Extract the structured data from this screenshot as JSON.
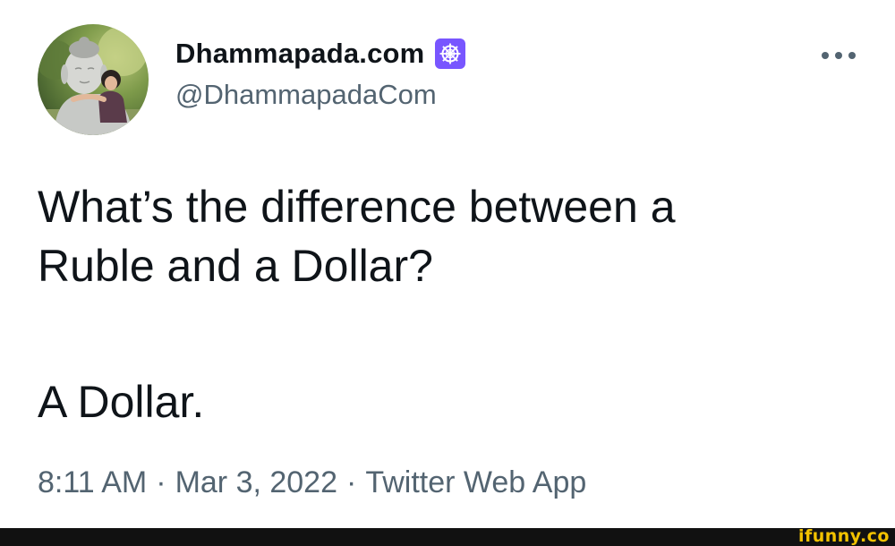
{
  "account": {
    "display_name": "Dhammapada.com",
    "handle": "@DhammapadaCom",
    "badge_icon": "dharma-wheel-icon",
    "badge_color": "#7856ff"
  },
  "tweet": {
    "lines": [
      "What’s the difference between a",
      "Ruble and a Dollar?",
      "A Dollar."
    ]
  },
  "meta": {
    "time": "8:11 AM",
    "separator": "·",
    "date": "Mar 3, 2022",
    "source": "Twitter Web App"
  },
  "menu": {
    "icon": "more-options-icon"
  },
  "watermark": {
    "text": "ifunny.co",
    "color": "#f2c200"
  },
  "colors": {
    "text_primary": "#0f1419",
    "text_secondary": "#536471",
    "background": "#ffffff",
    "footer": "#111111"
  }
}
